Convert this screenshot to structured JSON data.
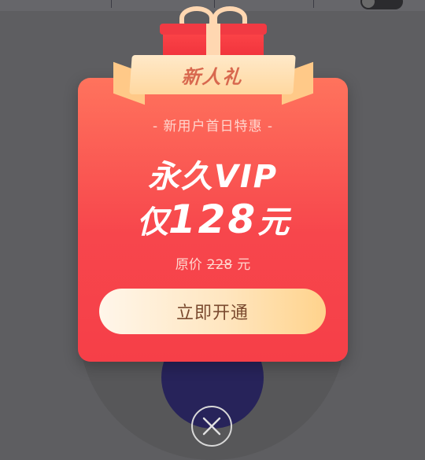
{
  "background": {
    "toggle_on": false
  },
  "popup": {
    "badge_label": "新人礼",
    "subtitle": "-  新用户首日特惠  -",
    "headline_line1": "永久VIP",
    "headline_prefix": "仅",
    "price": "128",
    "price_suffix": "元",
    "original_price_label": "原价",
    "original_price": "228",
    "original_price_unit": "元",
    "cta_label": "立即开通",
    "close_icon": "close-icon"
  },
  "colors": {
    "card_top": "#ff735d",
    "card_bottom": "#f63f48",
    "cta_gradient_end": "#ffd38c",
    "cta_text": "#7a4a2f"
  }
}
